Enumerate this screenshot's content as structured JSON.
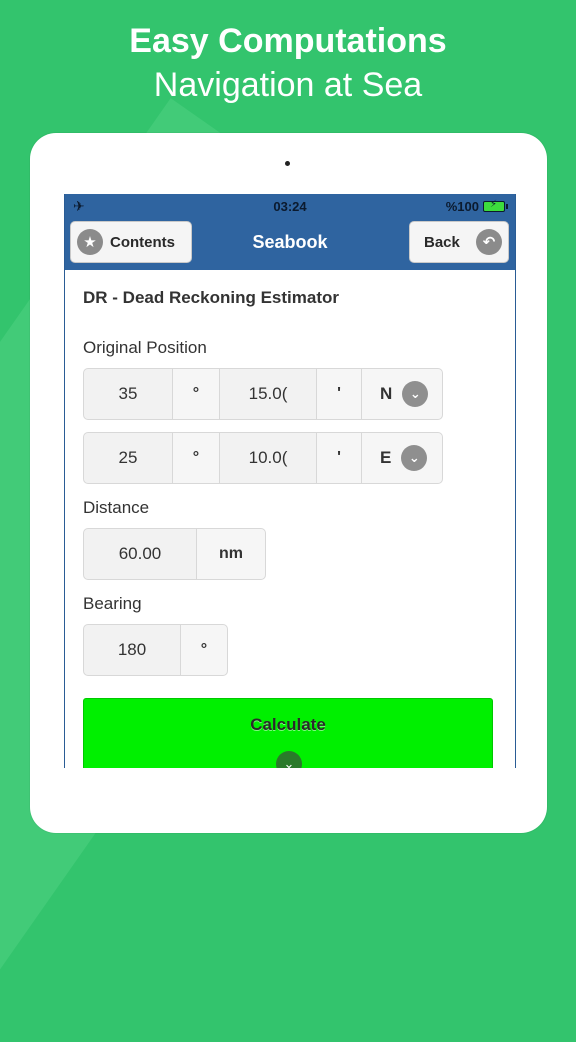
{
  "promo": {
    "title": "Easy Computations",
    "subtitle": "Navigation at Sea"
  },
  "statusbar": {
    "airplane_icon": "airplane-icon",
    "time": "03:24",
    "battery": "%100"
  },
  "navbar": {
    "title": "Seabook",
    "contents_label": "Contents",
    "back_label": "Back"
  },
  "form": {
    "heading": "DR - Dead Reckoning Estimator",
    "original_position_label": "Original Position",
    "lat": {
      "deg": "35",
      "deg_unit": "°",
      "min": "15.0(",
      "min_unit": "'",
      "hemi": "N"
    },
    "lon": {
      "deg": "25",
      "deg_unit": "°",
      "min": "10.0(",
      "min_unit": "'",
      "hemi": "E"
    },
    "distance_label": "Distance",
    "distance": {
      "value": "60.00",
      "unit": "nm"
    },
    "bearing_label": "Bearing",
    "bearing": {
      "value": "180",
      "unit": "°"
    },
    "calculate_label": "Calculate"
  },
  "colors": {
    "background": "#33c46d",
    "navbar": "#2f64a0",
    "calculate": "#00f000"
  }
}
